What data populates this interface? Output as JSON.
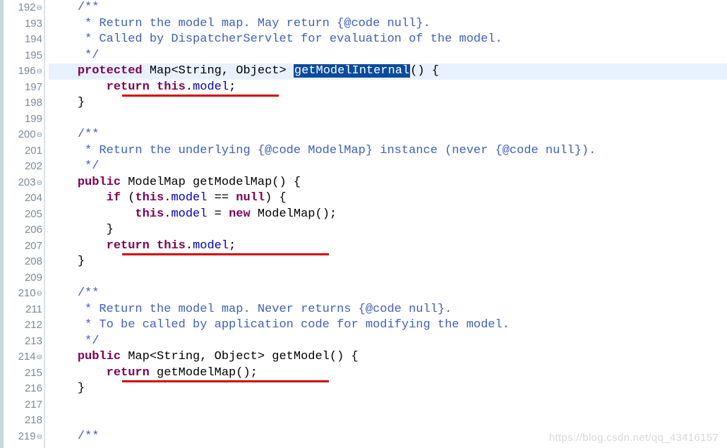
{
  "gutter": [
    {
      "num": "192",
      "fold": true
    },
    {
      "num": "193"
    },
    {
      "num": "194"
    },
    {
      "num": "195"
    },
    {
      "num": "196",
      "fold": true
    },
    {
      "num": "197"
    },
    {
      "num": "198"
    },
    {
      "num": "199"
    },
    {
      "num": "200",
      "fold": true
    },
    {
      "num": "201"
    },
    {
      "num": "202"
    },
    {
      "num": "203",
      "fold": true
    },
    {
      "num": "204"
    },
    {
      "num": "205"
    },
    {
      "num": "206"
    },
    {
      "num": "207"
    },
    {
      "num": "208"
    },
    {
      "num": "209"
    },
    {
      "num": "210",
      "fold": true
    },
    {
      "num": "211"
    },
    {
      "num": "212"
    },
    {
      "num": "213"
    },
    {
      "num": "214",
      "fold": true
    },
    {
      "num": "215"
    },
    {
      "num": "216"
    },
    {
      "num": "217"
    },
    {
      "num": "218"
    },
    {
      "num": "219",
      "fold": true
    }
  ],
  "lines": {
    "l192": {
      "indent": "    ",
      "c1": "/**"
    },
    "l193": {
      "indent": "     ",
      "c1": "* Return the model map. May return {@code null}."
    },
    "l194": {
      "indent": "     ",
      "c1": "* Called by DispatcherServlet for evaluation of the model."
    },
    "l195": {
      "indent": "     ",
      "c1": "*/"
    },
    "l196": {
      "indent": "    ",
      "kw": "protected",
      "t1": " Map<String, Object> ",
      "sel": "getModelInternal",
      "t2": "() {"
    },
    "l197": {
      "indent": "        ",
      "kw": "return",
      "kw2": "this",
      "t1": ".",
      "fld": "model",
      "t2": ";"
    },
    "l198": {
      "indent": "    ",
      "t1": "}"
    },
    "l199": {
      "indent": ""
    },
    "l200": {
      "indent": "    ",
      "c1": "/**"
    },
    "l201": {
      "indent": "     ",
      "c1": "* Return the underlying {@code ModelMap} instance (never {@code null})."
    },
    "l202": {
      "indent": "     ",
      "c1": "*/"
    },
    "l203": {
      "indent": "    ",
      "kw": "public",
      "t1": " ModelMap getModelMap() {"
    },
    "l204": {
      "indent": "        ",
      "kw": "if",
      "t1": " (",
      "kw2": "this",
      "t2": ".",
      "fld": "model",
      "t3": " == ",
      "kw3": "null",
      "t4": ") {"
    },
    "l205": {
      "indent": "            ",
      "kw": "this",
      "t1": ".",
      "fld": "model",
      "t2": " = ",
      "kw2": "new",
      "t3": " ModelMap();"
    },
    "l206": {
      "indent": "        ",
      "t1": "}"
    },
    "l207": {
      "indent": "        ",
      "kw": "return",
      "kw2": "this",
      "t1": ".",
      "fld": "model",
      "t2": ";"
    },
    "l208": {
      "indent": "    ",
      "t1": "}"
    },
    "l209": {
      "indent": ""
    },
    "l210": {
      "indent": "    ",
      "c1": "/**"
    },
    "l211": {
      "indent": "     ",
      "c1": "* Return the model map. Never returns {@code null}."
    },
    "l212": {
      "indent": "     ",
      "c1": "* To be called by application code for modifying the model."
    },
    "l213": {
      "indent": "     ",
      "c1": "*/"
    },
    "l214": {
      "indent": "    ",
      "kw": "public",
      "t1": " Map<String, Object> getModel() {"
    },
    "l215": {
      "indent": "        ",
      "kw": "return",
      "t1": " getModelMap();"
    },
    "l216": {
      "indent": "    ",
      "t1": "}"
    },
    "l217": {
      "indent": ""
    },
    "l218": {
      "indent": ""
    },
    "l219": {
      "indent": "    ",
      "c1": "/**"
    }
  },
  "watermark": "https://blog.csdn.net/qq_43416157",
  "foldGlyph": "⊖"
}
